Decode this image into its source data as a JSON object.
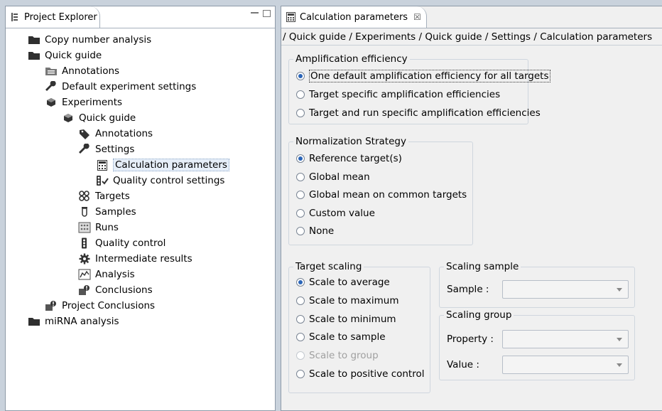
{
  "explorer": {
    "tab_label": "Project Explorer",
    "tree": [
      {
        "label": "Copy number analysis",
        "icon": "folder-icon",
        "level": 0
      },
      {
        "label": "Quick guide",
        "icon": "folder-icon",
        "level": 0
      },
      {
        "label": "Annotations",
        "icon": "annotations-icon",
        "level": 1
      },
      {
        "label": "Default experiment settings",
        "icon": "wrench-icon",
        "level": 1
      },
      {
        "label": "Experiments",
        "icon": "experiments-icon",
        "level": 1
      },
      {
        "label": "Quick guide",
        "icon": "experiment-icon",
        "level": 2
      },
      {
        "label": "Annotations",
        "icon": "tag-icon",
        "level": 3
      },
      {
        "label": "Settings",
        "icon": "wrench-icon",
        "level": 3
      },
      {
        "label": "Calculation parameters",
        "icon": "calculator-icon",
        "level": 4,
        "selected": true
      },
      {
        "label": "Quality control settings",
        "icon": "qc-settings-icon",
        "level": 4
      },
      {
        "label": "Targets",
        "icon": "targets-icon",
        "level": 3
      },
      {
        "label": "Samples",
        "icon": "samples-icon",
        "level": 3
      },
      {
        "label": "Runs",
        "icon": "runs-icon",
        "level": 3
      },
      {
        "label": "Quality control",
        "icon": "traffic-light-icon",
        "level": 3
      },
      {
        "label": "Intermediate results",
        "icon": "gear-icon",
        "level": 3
      },
      {
        "label": "Analysis",
        "icon": "chart-icon",
        "level": 3
      },
      {
        "label": "Conclusions",
        "icon": "conclusions-icon",
        "level": 3
      },
      {
        "label": "Project Conclusions",
        "icon": "conclusions-icon",
        "level": 1
      },
      {
        "label": "miRNA analysis",
        "icon": "folder-icon",
        "level": 0
      }
    ]
  },
  "editor": {
    "tab_label": "Calculation parameters",
    "close_symbol": "☒",
    "breadcrumb": "/ Quick guide / Experiments / Quick guide / Settings / Calculation parameters",
    "amplification": {
      "title": "Amplification efficiency",
      "options": [
        {
          "label": "One default amplification efficiency for all targets",
          "checked": true
        },
        {
          "label": "Target specific amplification efficiencies",
          "checked": false
        },
        {
          "label": "Target and run specific amplification efficiencies",
          "checked": false
        }
      ]
    },
    "normalization": {
      "title": "Normalization Strategy",
      "options": [
        {
          "label": "Reference target(s)",
          "checked": true
        },
        {
          "label": "Global mean",
          "checked": false
        },
        {
          "label": "Global mean on common targets",
          "checked": false
        },
        {
          "label": "Custom value",
          "checked": false
        },
        {
          "label": "None",
          "checked": false
        }
      ]
    },
    "target_scaling": {
      "title": "Target scaling",
      "options": [
        {
          "label": "Scale to average",
          "checked": true,
          "disabled": false
        },
        {
          "label": "Scale to maximum",
          "checked": false,
          "disabled": false
        },
        {
          "label": "Scale to minimum",
          "checked": false,
          "disabled": false
        },
        {
          "label": "Scale to sample",
          "checked": false,
          "disabled": false
        },
        {
          "label": "Scale to group",
          "checked": false,
          "disabled": true
        },
        {
          "label": "Scale to positive control",
          "checked": false,
          "disabled": false
        }
      ]
    },
    "scaling_sample": {
      "title": "Scaling sample",
      "sample_label": "Sample :",
      "sample_value": ""
    },
    "scaling_group": {
      "title": "Scaling group",
      "property_label": "Property :",
      "property_value": "",
      "value_label": "Value :",
      "value_value": ""
    }
  }
}
